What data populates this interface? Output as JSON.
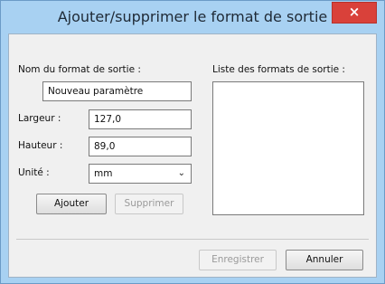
{
  "window": {
    "title": "Ajouter/supprimer le format de sortie",
    "close_glyph": "×"
  },
  "form": {
    "name_label": "Nom du format de sortie :",
    "name_value": "Nouveau paramètre",
    "width_label": "Largeur :",
    "width_value": "127,0",
    "height_label": "Hauteur :",
    "height_value": "89,0",
    "unit_label": "Unité :",
    "unit_value": "mm",
    "unit_chevron": "⌄"
  },
  "list": {
    "label": "Liste des formats de sortie :",
    "items": []
  },
  "buttons": {
    "add": "Ajouter",
    "remove": "Supprimer",
    "save": "Enregistrer",
    "cancel": "Annuler"
  },
  "colors": {
    "frame": "#a8d1f2",
    "close": "#d9413a",
    "client": "#f0f0f0"
  }
}
